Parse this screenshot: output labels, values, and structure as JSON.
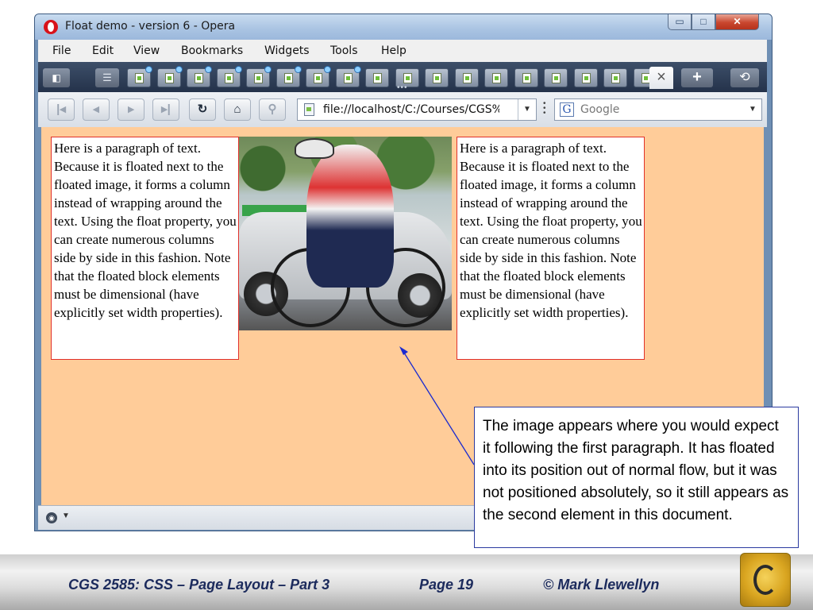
{
  "window": {
    "title": "Float demo - version 6 - Opera",
    "controls": {
      "minimize": "▭",
      "maximize": "□",
      "close": "✕"
    }
  },
  "menu": [
    {
      "label": "File"
    },
    {
      "label": "Edit"
    },
    {
      "label": "View"
    },
    {
      "label": "Bookmarks"
    },
    {
      "label": "Widgets"
    },
    {
      "label": "Tools"
    },
    {
      "label": "Help"
    }
  ],
  "tabs": {
    "count": 18,
    "close_icon": "close-icon",
    "new_tab": "+",
    "trash": "⟲"
  },
  "address": {
    "url": "file://localhost/C:/Courses/CGS%2"
  },
  "search": {
    "engine_letter": "G",
    "placeholder": "Google"
  },
  "content": {
    "paragraph": "Here is a paragraph of text. Because it is floated next to the floated image, it forms a column instead of wrapping around the text. Using the float property, you can create numerous columns side by side in this fashion. Note that the floated block elements must be dimensional (have explicitly set width properties).",
    "photo_icon": "cyclist-photo",
    "background_color": "#ffcc99",
    "border_color": "#e0302a"
  },
  "callout": {
    "text": "The image appears where you would expect it following the first paragraph. It has floated into its position out of normal flow, but it was not positioned absolutely, so it still appears as the second element in this document."
  },
  "footer": {
    "course": "CGS 2585: CSS – Page Layout – Part 3",
    "page": "Page 19",
    "author": "© Mark Llewellyn"
  }
}
